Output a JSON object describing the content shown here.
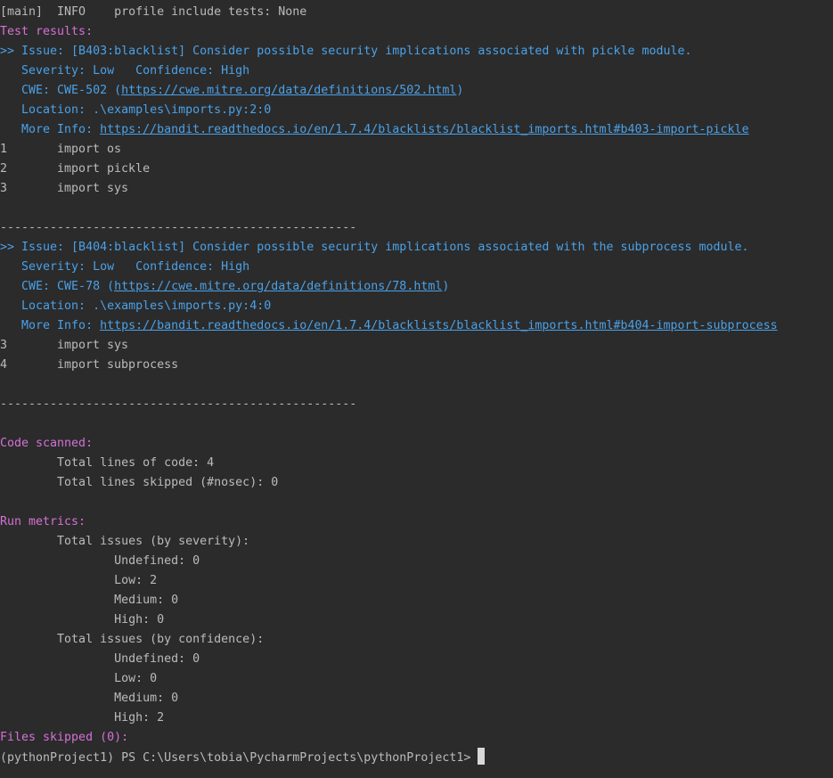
{
  "colors": {
    "background": "#2b2b2b",
    "default_text": "#bbbbbb",
    "heading": "#d670d6",
    "issue": "#4aa1e8"
  },
  "header_line": "[main]  INFO    profile include tests: None",
  "test_results_heading": "Test results:",
  "issues": [
    {
      "issue_line": ">> Issue: [B403:blacklist] Consider possible security implications associated with pickle module.",
      "severity_line": "   Severity: Low   Confidence: High",
      "cwe_prefix": "   CWE: CWE-502 (",
      "cwe_url": "https://cwe.mitre.org/data/definitions/502.html",
      "cwe_suffix": ")",
      "location_line": "   Location: .\\examples\\imports.py:2:0",
      "more_info_prefix": "   More Info: ",
      "more_info_url": "https://bandit.readthedocs.io/en/1.7.4/blacklists/blacklist_imports.html#b403-import-pickle",
      "code_lines": [
        {
          "num": "1",
          "code": "import os"
        },
        {
          "num": "2",
          "code": "import pickle"
        },
        {
          "num": "3",
          "code": "import sys"
        }
      ]
    },
    {
      "issue_line": ">> Issue: [B404:blacklist] Consider possible security implications associated with the subprocess module.",
      "severity_line": "   Severity: Low   Confidence: High",
      "cwe_prefix": "   CWE: CWE-78 (",
      "cwe_url": "https://cwe.mitre.org/data/definitions/78.html",
      "cwe_suffix": ")",
      "location_line": "   Location: .\\examples\\imports.py:4:0",
      "more_info_prefix": "   More Info: ",
      "more_info_url": "https://bandit.readthedocs.io/en/1.7.4/blacklists/blacklist_imports.html#b404-import-subprocess",
      "code_lines": [
        {
          "num": "3",
          "code": "import sys"
        },
        {
          "num": "4",
          "code": "import subprocess"
        }
      ]
    }
  ],
  "separator": "--------------------------------------------------",
  "code_scanned": {
    "heading": "Code scanned:",
    "total_lines": "        Total lines of code: 4",
    "skipped_lines": "        Total lines skipped (#nosec): 0"
  },
  "run_metrics": {
    "heading": "Run metrics:",
    "by_severity": "        Total issues (by severity):",
    "severity_undefined": "                Undefined: 0",
    "severity_low": "                Low: 2",
    "severity_medium": "                Medium: 0",
    "severity_high": "                High: 0",
    "by_confidence": "        Total issues (by confidence):",
    "confidence_undefined": "                Undefined: 0",
    "confidence_low": "                Low: 0",
    "confidence_medium": "                Medium: 0",
    "confidence_high": "                High: 2"
  },
  "files_skipped": "Files skipped (0):",
  "prompt": "(pythonProject1) PS C:\\Users\\tobia\\PycharmProjects\\pythonProject1>"
}
